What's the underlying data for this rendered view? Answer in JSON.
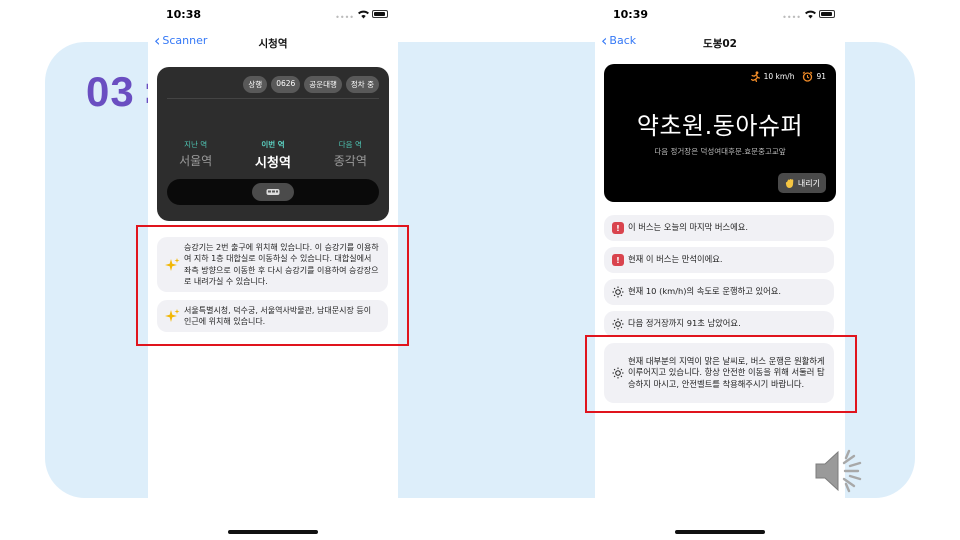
{
  "slide": {
    "section_number": "03"
  },
  "left_phone": {
    "status_time": "10:38",
    "back_label": "Scanner",
    "title": "시청역",
    "chips": [
      "상행",
      "0626",
      "공운대행",
      "정차 중"
    ],
    "stations": {
      "prev_label": "지난 역",
      "prev_name": "서울역",
      "current_label": "이번 역",
      "current_name": "시청역",
      "next_label": "다음 역",
      "next_name": "종각역"
    },
    "cards": [
      "승강기는 2번 출구에 위치해 있습니다. 이 승강기를 이용하여 지하 1층 대합실로 이동하실 수 있습니다. 대합실에서 좌측 방향으로 이동한 후 다시 승강기를 이용하여 승강장으로 내려가실 수 있습니다.",
      "서울특별시청, 덕수궁, 서울역사박물관, 남대문시장 등이 인근에 위치해 있습니다."
    ]
  },
  "right_phone": {
    "status_time": "10:39",
    "back_label": "Back",
    "title": "도봉02",
    "speed": "10 km/h",
    "timer_value": "91",
    "stop_name": "약초원.동아슈퍼",
    "next_stop": "다음 정거장은 덕성여대후문.효문중고교앞",
    "get_off_label": "내리기",
    "cards": [
      {
        "icon": "alert-icon",
        "text": "이 버스는 오늘의 마지막 버스에요."
      },
      {
        "icon": "alert-icon",
        "text": "현재 이 버스는 만석이에요."
      },
      {
        "icon": "sun-icon",
        "text": "현재 10 (km/h)의 속도로 운행하고 있어요."
      },
      {
        "icon": "sun-icon",
        "text": "다음 정거장까지 91초 남았어요."
      },
      {
        "icon": "sun-icon",
        "text": "현재 대부분의 지역이 맑은 날씨로, 버스 운행은 원활하게 이루어지고 있습니다. 항상 안전한 이동을 위해 서둘러 탑승하지 마시고, 안전벨트를 착용해주시기 바랍니다."
      }
    ]
  },
  "colors": {
    "accent": "#6a4ec1",
    "highlight": "#e0141d",
    "link": "#3478f6",
    "station_teal": "#4fc6b5"
  }
}
